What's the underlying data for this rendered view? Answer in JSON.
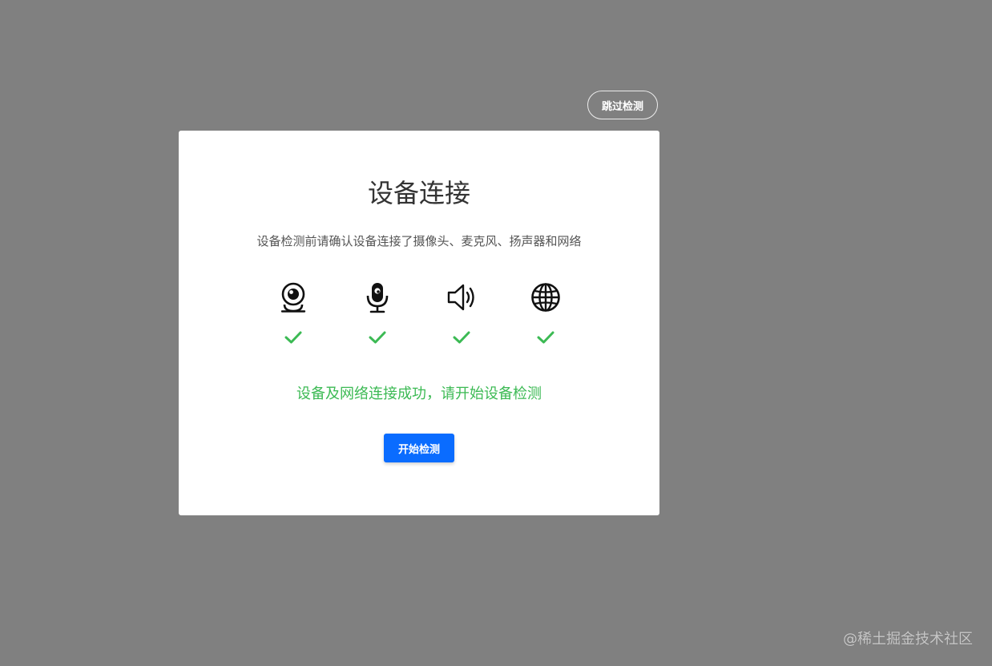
{
  "skip_button": {
    "label": "跳过检测"
  },
  "dialog": {
    "title": "设备连接",
    "subtitle": "设备检测前请确认设备连接了摄像头、麦克风、扬声器和网络",
    "devices": [
      {
        "icon": "camera-icon",
        "status": "connected"
      },
      {
        "icon": "microphone-icon",
        "status": "connected"
      },
      {
        "icon": "speaker-icon",
        "status": "connected"
      },
      {
        "icon": "globe-icon",
        "status": "connected"
      }
    ],
    "status_message": "设备及网络连接成功，请开始设备检测",
    "start_button": {
      "label": "开始检测"
    }
  },
  "watermark": "@稀土掘金技术社区",
  "colors": {
    "overlay": "#808080",
    "success": "#3cba54",
    "primary": "#0a6cff"
  }
}
